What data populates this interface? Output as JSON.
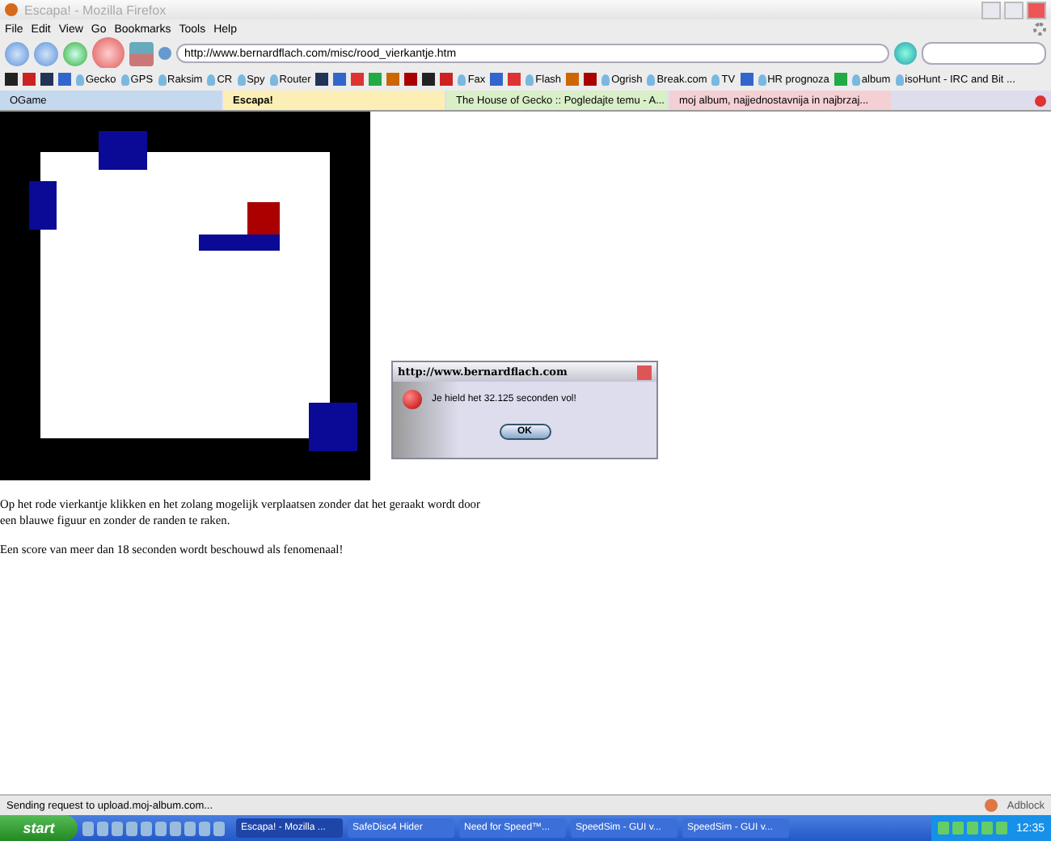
{
  "window": {
    "title": "Escapa! - Mozilla Firefox"
  },
  "menu": [
    "File",
    "Edit",
    "View",
    "Go",
    "Bookmarks",
    "Tools",
    "Help"
  ],
  "address": {
    "value": "http://www.bernardflach.com/misc/rood_vierkantje.htm"
  },
  "bookmarks": [
    {
      "kind": "icon"
    },
    {
      "kind": "icon"
    },
    {
      "kind": "icon"
    },
    {
      "kind": "icon"
    },
    {
      "kind": "link",
      "label": "Gecko"
    },
    {
      "kind": "link",
      "label": "GPS"
    },
    {
      "kind": "link",
      "label": "Raksim"
    },
    {
      "kind": "link",
      "label": "CR"
    },
    {
      "kind": "link",
      "label": "Spy"
    },
    {
      "kind": "link",
      "label": "Router"
    },
    {
      "kind": "icon"
    },
    {
      "kind": "icon"
    },
    {
      "kind": "icon"
    },
    {
      "kind": "icon"
    },
    {
      "kind": "icon"
    },
    {
      "kind": "icon"
    },
    {
      "kind": "icon"
    },
    {
      "kind": "icon"
    },
    {
      "kind": "link",
      "label": "Fax"
    },
    {
      "kind": "icon"
    },
    {
      "kind": "icon"
    },
    {
      "kind": "link",
      "label": "Flash"
    },
    {
      "kind": "icon"
    },
    {
      "kind": "icon"
    },
    {
      "kind": "link",
      "label": "Ogrish"
    },
    {
      "kind": "link",
      "label": "Break.com"
    },
    {
      "kind": "link",
      "label": "TV"
    },
    {
      "kind": "icon"
    },
    {
      "kind": "link",
      "label": "HR prognoza"
    },
    {
      "kind": "icon"
    },
    {
      "kind": "link",
      "label": "album"
    },
    {
      "kind": "link",
      "label": "isoHunt - IRC and Bit ..."
    }
  ],
  "tabs": [
    {
      "label": "OGame",
      "selected": false
    },
    {
      "label": "Escapa!",
      "selected": true
    },
    {
      "label": "The House of Gecko :: Pogledajte temu - A...",
      "selected": false
    },
    {
      "label": "moj album, najjednostavnija in najbrzaj...",
      "selected": false
    }
  ],
  "content": {
    "paragraphs": [
      "Op het rode vierkantje klikken en het zolang mogelijk verplaatsen zonder dat het geraakt wordt door een blauwe figuur en zonder de randen te raken.",
      "Een score van meer dan 18 seconden wordt beschouwd als fenomenaal!"
    ]
  },
  "dialog": {
    "title": "http://www.bernardflach.com",
    "message": "Je hield het 32.125 seconden vol!",
    "button": "OK"
  },
  "status_bar": {
    "text": "Sending request to upload.moj-album.com...",
    "addon": "Adblock"
  },
  "taskbar": {
    "start": "start",
    "tasks": [
      {
        "label": "Escapa! - Mozilla ...",
        "selected": true
      },
      {
        "label": "SafeDisc4 Hider",
        "selected": false
      },
      {
        "label": "Need for Speed™...",
        "selected": false
      },
      {
        "label": "SpeedSim - GUI v...",
        "selected": false
      },
      {
        "label": "SpeedSim - GUI v...",
        "selected": false
      }
    ],
    "clock": "12:35"
  }
}
